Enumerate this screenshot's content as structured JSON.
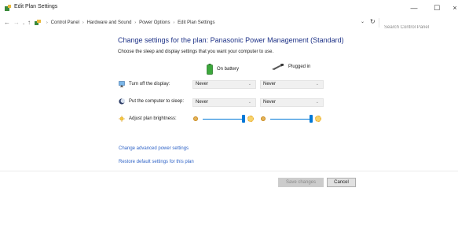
{
  "window": {
    "title": "Edit Plan Settings",
    "minimize": "—",
    "maximize": "☐",
    "close": "×"
  },
  "address_bar": {
    "back": "←",
    "forward": "→",
    "recent": "⌄",
    "up": "↑",
    "crumbs": [
      "Control Panel",
      "Hardware and Sound",
      "Power Options",
      "Edit Plan Settings"
    ],
    "separator": "›",
    "dropdown": "⌄",
    "refresh": "↻",
    "search_placeholder": "Search Control Panel"
  },
  "main": {
    "heading": "Change settings for the plan: Panasonic Power Management (Standard)",
    "subheading": "Choose the sleep and display settings that you want your computer to use.",
    "columns": {
      "battery": "On battery",
      "plugged": "Plugged in"
    },
    "rows": {
      "display_label": "Turn off the display:",
      "sleep_label": "Put the computer to sleep:",
      "brightness_label": "Adjust plan brightness:"
    },
    "values": {
      "display_battery": "Never",
      "display_plugged": "Never",
      "sleep_battery": "Never",
      "sleep_plugged": "Never",
      "brightness_battery": 1.0,
      "brightness_plugged": 1.0
    },
    "caret": "⌄",
    "links": {
      "advanced": "Change advanced power settings",
      "restore": "Restore default settings for this plan"
    },
    "buttons": {
      "save": "Save changes",
      "cancel": "Cancel"
    }
  },
  "colors": {
    "heading": "#1e3287",
    "link": "#2f63c7",
    "accent": "#0078d7"
  }
}
